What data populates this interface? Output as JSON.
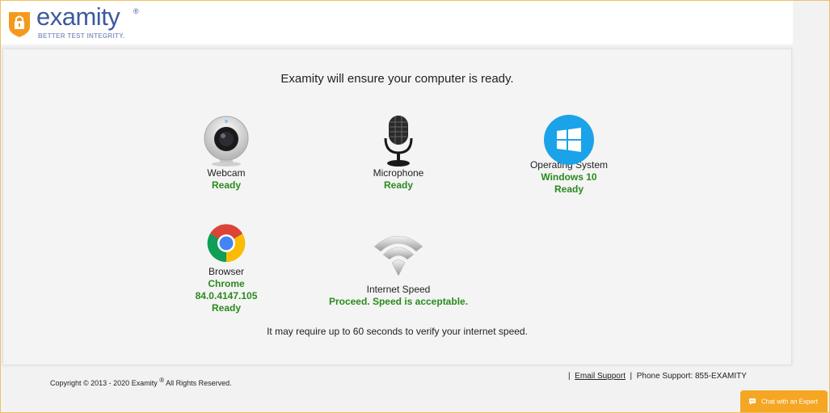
{
  "brand": {
    "name": "examity",
    "registered": "®",
    "tagline": "BETTER TEST INTEGRITY."
  },
  "main": {
    "heading": "Examity will ensure your computer is ready.",
    "checks": {
      "webcam": {
        "label": "Webcam",
        "status": [
          "Ready"
        ]
      },
      "microphone": {
        "label": "Microphone",
        "status": [
          "Ready"
        ]
      },
      "os": {
        "label": "Operating System",
        "status": [
          "Windows 10",
          "Ready"
        ]
      },
      "browser": {
        "label": "Browser",
        "status": [
          "Chrome",
          "84.0.4147.105",
          "Ready"
        ]
      },
      "internet": {
        "label": "Internet Speed",
        "status": [
          "Proceed. Speed is acceptable."
        ]
      }
    },
    "note": "It may require up to 60 seconds to verify your internet speed."
  },
  "footer": {
    "copyright_prefix": "Copyright © 2013 - 2020 Examity",
    "copyright_reg": "®",
    "copyright_suffix": "All Rights Reserved.",
    "sep1": "|",
    "email_support": "Email Support",
    "sep2": "|",
    "phone_support": "Phone Support: 855-EXAMITY"
  },
  "chat": {
    "label": "Chat with an Expert"
  },
  "colors": {
    "brand_blue": "#3e5a9e",
    "ready_green": "#2a8a1e",
    "windows_blue": "#1aa3e8",
    "chat_orange": "#f5a623"
  }
}
